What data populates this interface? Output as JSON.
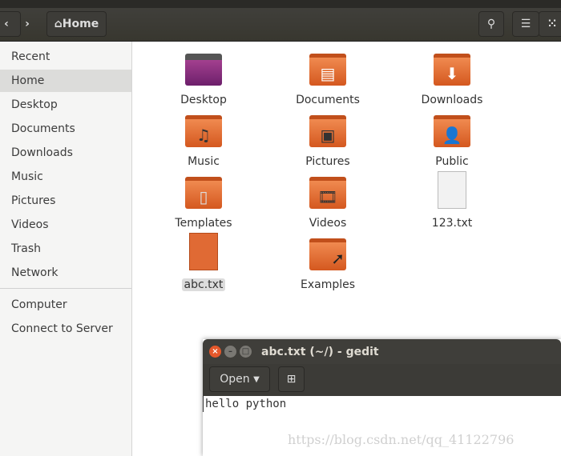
{
  "header": {
    "back": "‹",
    "forward": "›",
    "location": "Home",
    "search_icon": "search-icon",
    "list_view_icon": "list-icon",
    "grid_view_icon": "grid-icon"
  },
  "sidebar": {
    "items": [
      {
        "label": "Recent"
      },
      {
        "label": "Home",
        "selected": true
      },
      {
        "label": "Desktop"
      },
      {
        "label": "Documents"
      },
      {
        "label": "Downloads"
      },
      {
        "label": "Music"
      },
      {
        "label": "Pictures"
      },
      {
        "label": "Videos"
      },
      {
        "label": "Trash"
      },
      {
        "label": "Network"
      }
    ],
    "bottom": [
      {
        "label": "Computer"
      },
      {
        "label": "Connect to Server"
      }
    ]
  },
  "files": [
    {
      "label": "Desktop",
      "icon": "desktop-folder"
    },
    {
      "label": "Documents",
      "icon": "documents-folder"
    },
    {
      "label": "Downloads",
      "icon": "downloads-folder"
    },
    {
      "label": "Music",
      "icon": "music-folder"
    },
    {
      "label": "Pictures",
      "icon": "pictures-folder"
    },
    {
      "label": "Public",
      "icon": "public-folder"
    },
    {
      "label": "Templates",
      "icon": "templates-folder"
    },
    {
      "label": "Videos",
      "icon": "videos-folder"
    },
    {
      "label": "123.txt",
      "icon": "text-file"
    },
    {
      "label": "abc.txt",
      "icon": "text-file-orange",
      "selected": true
    },
    {
      "label": "Examples",
      "icon": "link-folder"
    }
  ],
  "gedit": {
    "title": "abc.txt (~/) - gedit",
    "open_label": "Open",
    "new_tab_icon": "new-document-icon",
    "text": "hello python"
  },
  "watermark": "https://blog.csdn.net/qq_41122796",
  "colors": {
    "accent": "#e95420",
    "folder": "#e0703a"
  }
}
